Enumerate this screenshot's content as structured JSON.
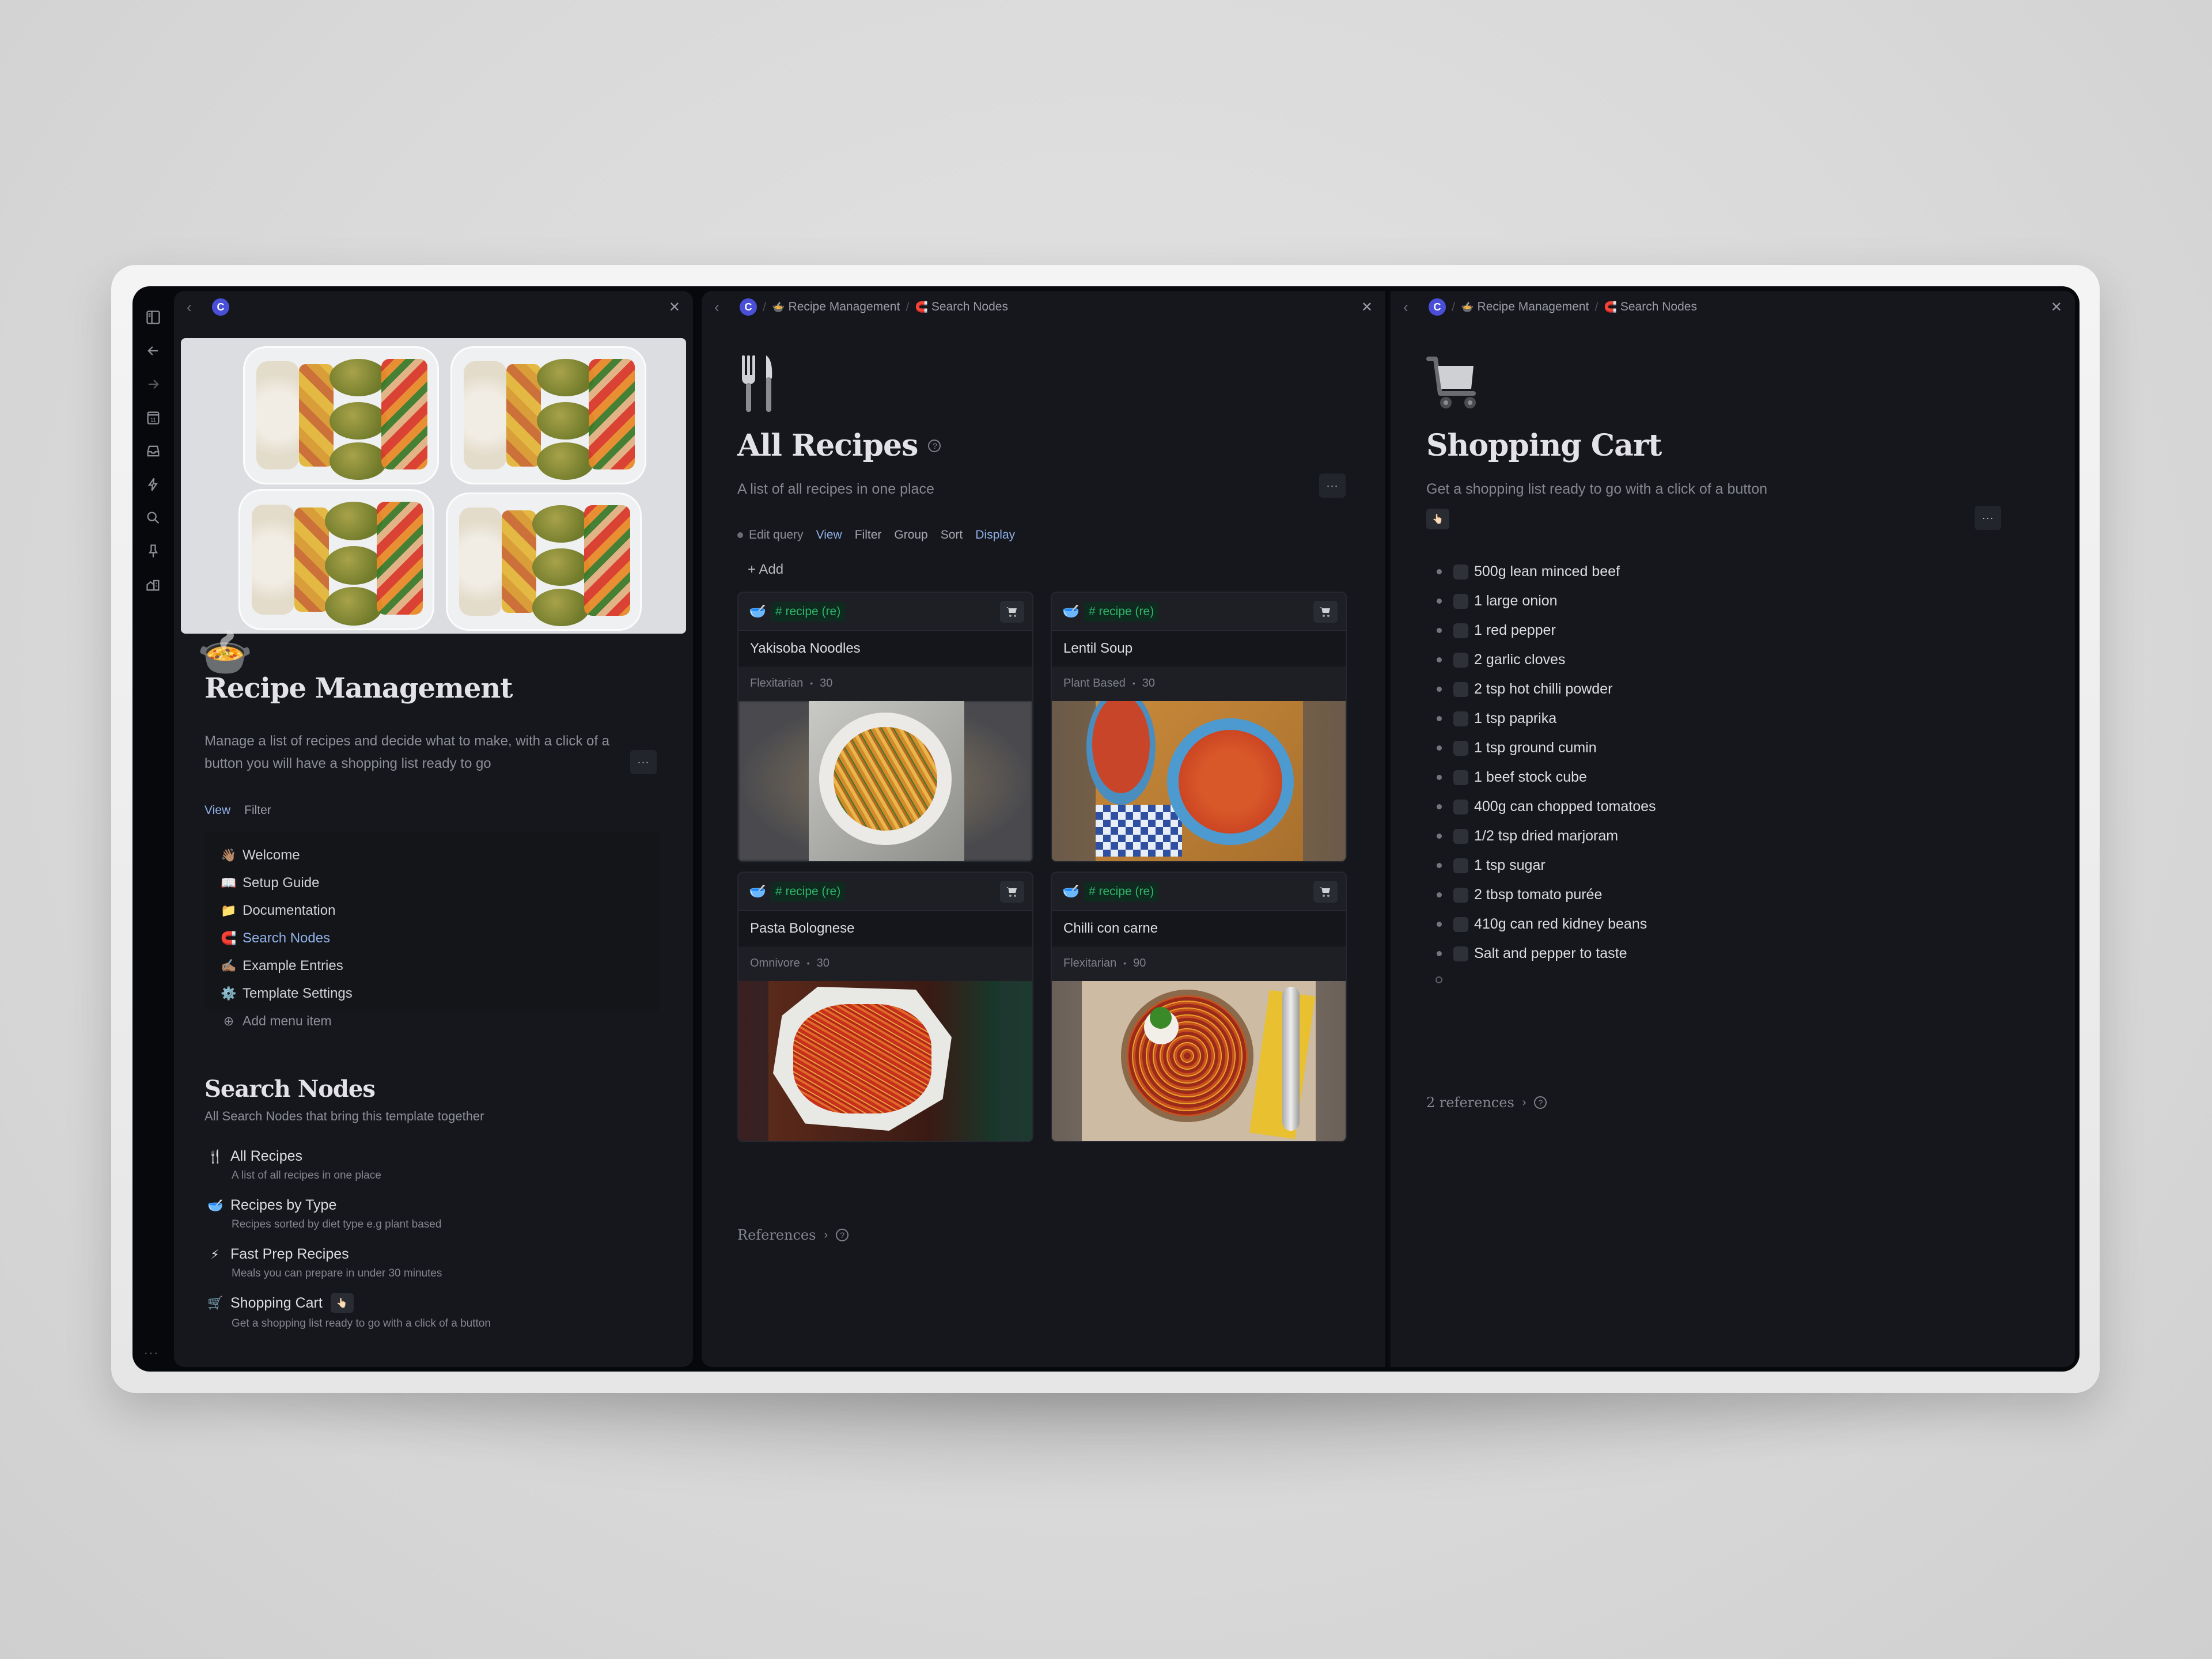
{
  "app": {
    "workspace_badge": "C",
    "rail_icons": [
      "sidebar-toggle-icon",
      "back-arrow-icon",
      "forward-arrow-icon",
      "calendar-icon",
      "inbox-icon",
      "lightning-icon",
      "search-icon",
      "pin-icon",
      "home-icon"
    ],
    "calendar_day": "11",
    "rail_more": "···"
  },
  "panel_left": {
    "title": "Recipe Management",
    "description": "Manage a list of recipes and decide what to make, with a click of a button you will have a shopping list ready to go",
    "more_label": "···",
    "view_tabs": [
      {
        "label": "View",
        "active": true
      },
      {
        "label": "Filter",
        "active": false
      }
    ],
    "menu": [
      {
        "icon": "👋🏽",
        "icon_name": "waving-hand-icon",
        "label": "Welcome"
      },
      {
        "icon": "📖",
        "icon_name": "book-icon",
        "label": "Setup Guide"
      },
      {
        "icon": "📁",
        "icon_name": "folder-icon",
        "label": "Documentation"
      },
      {
        "icon": "🧲",
        "icon_name": "magnet-icon",
        "label": "Search Nodes",
        "selected": true
      },
      {
        "icon": "✍🏽",
        "icon_name": "writing-hand-icon",
        "label": "Example Entries"
      },
      {
        "icon": "⚙️",
        "icon_name": "gear-icon",
        "label": "Template Settings"
      }
    ],
    "add_menu_item": "Add menu item",
    "search_nodes": {
      "title": "Search Nodes",
      "subtitle": "All Search Nodes that bring this template together",
      "items": [
        {
          "icon": "🍴",
          "icon_name": "fork-knife-icon",
          "label": "All Recipes",
          "sub": "A list of all recipes in one place"
        },
        {
          "icon": "🥣",
          "icon_name": "bowl-icon",
          "label": "Recipes by Type",
          "sub": "Recipes sorted by diet type e.g plant based"
        },
        {
          "icon": "⚡",
          "icon_name": "lightning-icon",
          "label": "Fast Prep Recipes",
          "sub": "Meals you can prepare in under 30 minutes"
        },
        {
          "icon": "🛒",
          "icon_name": "shopping-cart-icon",
          "label": "Shopping Cart",
          "sub": "Get a shopping list ready to go with a click of a button",
          "has_button": true
        }
      ]
    }
  },
  "panel_middle": {
    "breadcrumb": [
      {
        "icon": "🍲",
        "label": "Recipe Management"
      },
      {
        "icon": "🧲",
        "label": "Search Nodes"
      }
    ],
    "title": "All Recipes",
    "description": "A list of all recipes in one place",
    "more_label": "···",
    "query_bar": {
      "edit_query": "Edit query",
      "items": [
        {
          "label": "View",
          "active": true
        },
        {
          "label": "Filter",
          "active": false
        },
        {
          "label": "Group",
          "active": false
        },
        {
          "label": "Sort",
          "active": false
        },
        {
          "label": "Display",
          "active": true
        }
      ]
    },
    "add_label": "+ Add",
    "cards": [
      {
        "tag": "# recipe (re)",
        "name": "Yakisoba Noodles",
        "diet": "Flexitarian",
        "time": "30",
        "image": "noodles"
      },
      {
        "tag": "# recipe (re)",
        "name": "Lentil Soup",
        "diet": "Plant Based",
        "time": "30",
        "image": "lentil"
      },
      {
        "tag": "# recipe (re)",
        "name": "Pasta Bolognese",
        "diet": "Omnivore",
        "time": "30",
        "image": "pasta"
      },
      {
        "tag": "# recipe (re)",
        "name": "Chilli con carne",
        "diet": "Flexitarian",
        "time": "90",
        "image": "chilli"
      }
    ],
    "references_label": "References",
    "colors": {
      "tag_text": "#2fb56a",
      "tag_bg": "#0f2a1f",
      "link": "#8fb0e8"
    }
  },
  "panel_right": {
    "breadcrumb": [
      {
        "icon": "🍲",
        "label": "Recipe Management"
      },
      {
        "icon": "🧲",
        "label": "Search Nodes"
      }
    ],
    "title": "Shopping Cart",
    "description": "Get a shopping list ready to go with a click of a button",
    "more_label": "···",
    "items": [
      "500g lean minced beef",
      "1 large onion",
      "1 red pepper",
      "2 garlic cloves",
      "2 tsp hot chilli powder",
      "1 tsp paprika",
      "1 tsp ground cumin",
      "1 beef stock cube",
      "400g can chopped tomatoes",
      "1/2 tsp dried marjoram",
      "1 tsp sugar",
      "2 tbsp tomato purée",
      "410g can red kidney beans",
      "Salt and pepper to taste"
    ],
    "references_label": "2 references"
  }
}
